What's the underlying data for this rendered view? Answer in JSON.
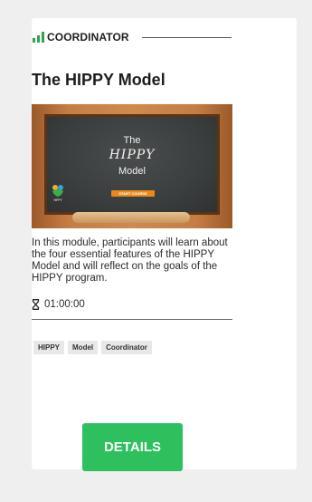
{
  "card": {
    "role": "COORDINATOR",
    "title": "The HIPPY Model",
    "thumbnail": {
      "line1": "The",
      "line2": "HIPPY",
      "line3": "Model",
      "button_label": "START COURSE",
      "logo_text": "HIPPY"
    },
    "description": "In this module, participants will learn about the four essential features of the HIPPY Model and will reflect on the goals of the HIPPY program.",
    "duration": "01:00:00",
    "tags": [
      "HIPPY",
      "Model",
      "Coordinator"
    ],
    "details_label": "DETAILS"
  },
  "colors": {
    "accent_green": "#2ec05c",
    "icon_green": "#2aa44f",
    "page_bg": "#efefef"
  },
  "icons": {
    "role": "signal-bars-icon",
    "duration": "hourglass-icon"
  }
}
